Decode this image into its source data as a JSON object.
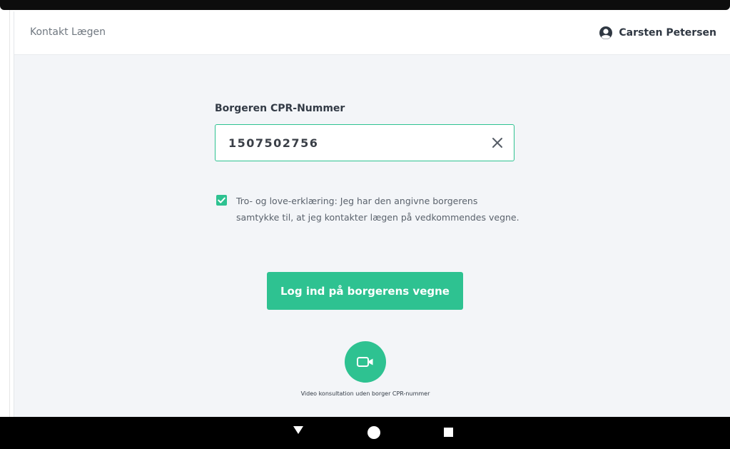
{
  "header": {
    "title": "Kontakt Lægen",
    "user_name": "Carsten Petersen",
    "user_icon": "user-circle-icon"
  },
  "form": {
    "cpr_label": "Borgeren CPR-Nummer",
    "cpr_value": "1507502756",
    "clear_icon": "close-icon",
    "consent_checked": true,
    "consent_text": "Tro- og love-erklæring: Jeg har den angivne borgerens samtykke til, at jeg kontakter lægen på vedkommendes vegne."
  },
  "actions": {
    "login_label": "Log ind på borgerens vegne",
    "video_icon": "video-camera-icon",
    "video_label": "Video konsultation uden borger CPR-nummer"
  },
  "system_nav": {
    "back_icon": "back-triangle-icon",
    "home_icon": "home-circle-icon",
    "recents_icon": "recents-square-icon"
  },
  "colors": {
    "accent": "#2ec291",
    "background": "#f3f5f8",
    "text_dark": "#333b46"
  }
}
